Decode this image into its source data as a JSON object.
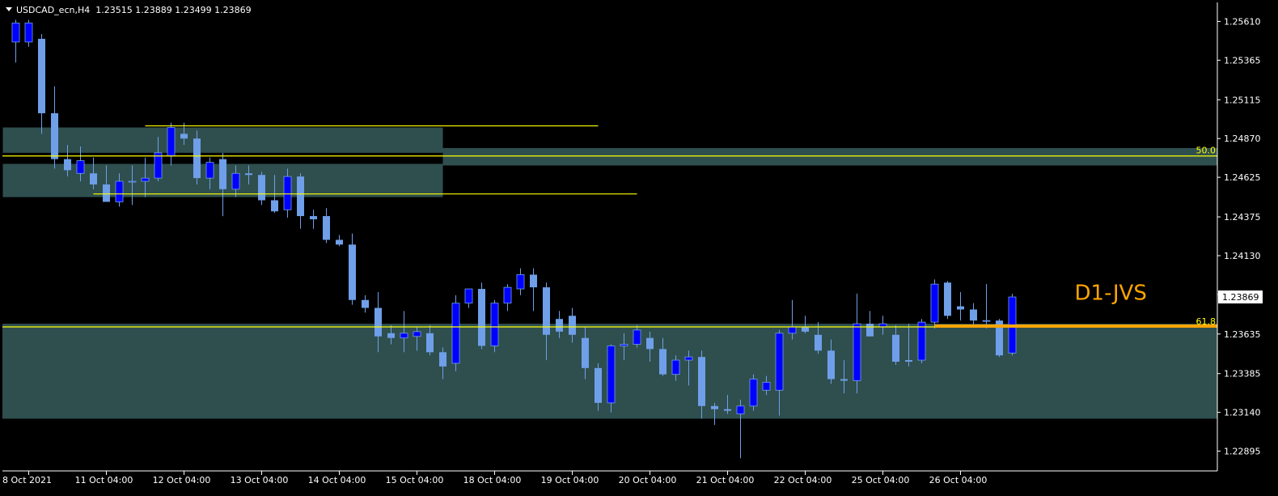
{
  "header": {
    "symbol_line": "USDCAD_ecn,H4  1.23515 1.23889 1.23499 1.23869"
  },
  "colors": {
    "background": "#000000",
    "axis": "#ffffff",
    "text": "#ffffff",
    "bull": "#0000ff",
    "bear": "#6f9fe8",
    "wick": "#6f9fe8",
    "zone": "#2f4f4f",
    "yellow": "#ffff00",
    "orange": "#ffa500",
    "red_arrow": "#ff0000",
    "fib_text": "#ffff00"
  },
  "chart_data": {
    "type": "candlestick",
    "ylim": [
      1.2277,
      1.2573
    ],
    "y_ticks": [
      "1.25610",
      "1.25365",
      "1.25115",
      "1.24870",
      "1.24625",
      "1.24375",
      "1.24130",
      "1.23885",
      "1.23635",
      "1.23385",
      "1.23140",
      "1.22895"
    ],
    "y_tick_values": [
      1.2561,
      1.25365,
      1.25115,
      1.2487,
      1.24625,
      1.24375,
      1.2413,
      1.23885,
      1.23635,
      1.23385,
      1.2314,
      1.22895
    ],
    "x_labels": [
      {
        "label": "8 Oct 2021",
        "index": 1
      },
      {
        "label": "11 Oct 04:00",
        "index": 7
      },
      {
        "label": "12 Oct 04:00",
        "index": 13
      },
      {
        "label": "13 Oct 04:00",
        "index": 19
      },
      {
        "label": "14 Oct 04:00",
        "index": 25
      },
      {
        "label": "15 Oct 04:00",
        "index": 31
      },
      {
        "label": "18 Oct 04:00",
        "index": 37
      },
      {
        "label": "19 Oct 04:00",
        "index": 43
      },
      {
        "label": "20 Oct 04:00",
        "index": 49
      },
      {
        "label": "21 Oct 04:00",
        "index": 55
      },
      {
        "label": "22 Oct 04:00",
        "index": 61
      },
      {
        "label": "25 Oct 04:00",
        "index": 67
      },
      {
        "label": "26 Oct 04:00",
        "index": 73
      }
    ],
    "current_price": "1.23869",
    "current_price_value": 1.23869,
    "candles": [
      {
        "o": 1.2548,
        "h": 1.2562,
        "l": 1.2535,
        "c": 1.256
      },
      {
        "o": 1.2548,
        "h": 1.2562,
        "l": 1.2545,
        "c": 1.256
      },
      {
        "o": 1.255,
        "h": 1.2553,
        "l": 1.249,
        "c": 1.2503
      },
      {
        "o": 1.2503,
        "h": 1.252,
        "l": 1.2468,
        "c": 1.2474
      },
      {
        "o": 1.2474,
        "h": 1.2483,
        "l": 1.2463,
        "c": 1.2467
      },
      {
        "o": 1.2465,
        "h": 1.2482,
        "l": 1.246,
        "c": 1.2473
      },
      {
        "o": 1.2465,
        "h": 1.2475,
        "l": 1.2455,
        "c": 1.2458
      },
      {
        "o": 1.2458,
        "h": 1.247,
        "l": 1.245,
        "c": 1.2447
      },
      {
        "o": 1.2447,
        "h": 1.2465,
        "l": 1.2444,
        "c": 1.246
      },
      {
        "o": 1.246,
        "h": 1.247,
        "l": 1.2445,
        "c": 1.246
      },
      {
        "o": 1.246,
        "h": 1.2475,
        "l": 1.245,
        "c": 1.2462
      },
      {
        "o": 1.2462,
        "h": 1.2488,
        "l": 1.246,
        "c": 1.2478
      },
      {
        "o": 1.2476,
        "h": 1.2497,
        "l": 1.247,
        "c": 1.2494
      },
      {
        "o": 1.249,
        "h": 1.2497,
        "l": 1.2483,
        "c": 1.2487
      },
      {
        "o": 1.2487,
        "h": 1.2492,
        "l": 1.2458,
        "c": 1.2462
      },
      {
        "o": 1.2462,
        "h": 1.2475,
        "l": 1.2455,
        "c": 1.2472
      },
      {
        "o": 1.2474,
        "h": 1.2478,
        "l": 1.2438,
        "c": 1.2455
      },
      {
        "o": 1.2455,
        "h": 1.247,
        "l": 1.245,
        "c": 1.2465
      },
      {
        "o": 1.2465,
        "h": 1.247,
        "l": 1.2458,
        "c": 1.2464
      },
      {
        "o": 1.2464,
        "h": 1.2466,
        "l": 1.2445,
        "c": 1.2448
      },
      {
        "o": 1.2448,
        "h": 1.2464,
        "l": 1.244,
        "c": 1.2441
      },
      {
        "o": 1.2442,
        "h": 1.2468,
        "l": 1.2437,
        "c": 1.2463
      },
      {
        "o": 1.2463,
        "h": 1.2465,
        "l": 1.243,
        "c": 1.2438
      },
      {
        "o": 1.2438,
        "h": 1.2442,
        "l": 1.243,
        "c": 1.2436
      },
      {
        "o": 1.2438,
        "h": 1.2443,
        "l": 1.2421,
        "c": 1.2423
      },
      {
        "o": 1.2423,
        "h": 1.2426,
        "l": 1.2419,
        "c": 1.242
      },
      {
        "o": 1.242,
        "h": 1.2427,
        "l": 1.2382,
        "c": 1.2385
      },
      {
        "o": 1.2385,
        "h": 1.2388,
        "l": 1.2377,
        "c": 1.238
      },
      {
        "o": 1.238,
        "h": 1.239,
        "l": 1.2352,
        "c": 1.2362
      },
      {
        "o": 1.2364,
        "h": 1.2369,
        "l": 1.2357,
        "c": 1.2361
      },
      {
        "o": 1.2361,
        "h": 1.2378,
        "l": 1.2352,
        "c": 1.2364
      },
      {
        "o": 1.2362,
        "h": 1.2368,
        "l": 1.2353,
        "c": 1.2365
      },
      {
        "o": 1.2364,
        "h": 1.2369,
        "l": 1.235,
        "c": 1.2352
      },
      {
        "o": 1.2352,
        "h": 1.2355,
        "l": 1.2335,
        "c": 1.2343
      },
      {
        "o": 1.2345,
        "h": 1.2388,
        "l": 1.234,
        "c": 1.2383
      },
      {
        "o": 1.2383,
        "h": 1.2392,
        "l": 1.238,
        "c": 1.2392
      },
      {
        "o": 1.2392,
        "h": 1.2396,
        "l": 1.2354,
        "c": 1.2356
      },
      {
        "o": 1.2356,
        "h": 1.2385,
        "l": 1.2352,
        "c": 1.2383
      },
      {
        "o": 1.2383,
        "h": 1.2395,
        "l": 1.2378,
        "c": 1.2393
      },
      {
        "o": 1.2392,
        "h": 1.2405,
        "l": 1.2388,
        "c": 1.2401
      },
      {
        "o": 1.2401,
        "h": 1.2405,
        "l": 1.2378,
        "c": 1.2393
      },
      {
        "o": 1.2393,
        "h": 1.2396,
        "l": 1.2347,
        "c": 1.2363
      },
      {
        "o": 1.2373,
        "h": 1.2378,
        "l": 1.2361,
        "c": 1.2365
      },
      {
        "o": 1.2375,
        "h": 1.238,
        "l": 1.2358,
        "c": 1.2363
      },
      {
        "o": 1.2361,
        "h": 1.2368,
        "l": 1.2335,
        "c": 1.2342
      },
      {
        "o": 1.2342,
        "h": 1.2345,
        "l": 1.2315,
        "c": 1.232
      },
      {
        "o": 1.232,
        "h": 1.2357,
        "l": 1.2314,
        "c": 1.2356
      },
      {
        "o": 1.2356,
        "h": 1.2364,
        "l": 1.2347,
        "c": 1.2357
      },
      {
        "o": 1.2357,
        "h": 1.2369,
        "l": 1.2355,
        "c": 1.2366
      },
      {
        "o": 1.2361,
        "h": 1.2365,
        "l": 1.2346,
        "c": 1.2354
      },
      {
        "o": 1.2354,
        "h": 1.2361,
        "l": 1.2337,
        "c": 1.2338
      },
      {
        "o": 1.2338,
        "h": 1.235,
        "l": 1.2334,
        "c": 1.2347
      },
      {
        "o": 1.2347,
        "h": 1.2353,
        "l": 1.2331,
        "c": 1.2349
      },
      {
        "o": 1.2349,
        "h": 1.2353,
        "l": 1.231,
        "c": 1.2318
      },
      {
        "o": 1.2318,
        "h": 1.232,
        "l": 1.2306,
        "c": 1.2316
      },
      {
        "o": 1.2316,
        "h": 1.2325,
        "l": 1.2313,
        "c": 1.2315
      },
      {
        "o": 1.2313,
        "h": 1.2322,
        "l": 1.2285,
        "c": 1.2318
      },
      {
        "o": 1.2318,
        "h": 1.2338,
        "l": 1.2315,
        "c": 1.2335
      },
      {
        "o": 1.2328,
        "h": 1.2337,
        "l": 1.2325,
        "c": 1.2333
      },
      {
        "o": 1.2328,
        "h": 1.2366,
        "l": 1.2312,
        "c": 1.2364
      },
      {
        "o": 1.2364,
        "h": 1.2385,
        "l": 1.236,
        "c": 1.2368
      },
      {
        "o": 1.2368,
        "h": 1.2375,
        "l": 1.2364,
        "c": 1.2365
      },
      {
        "o": 1.2363,
        "h": 1.2371,
        "l": 1.2351,
        "c": 1.2353
      },
      {
        "o": 1.2353,
        "h": 1.236,
        "l": 1.2332,
        "c": 1.2335
      },
      {
        "o": 1.2335,
        "h": 1.2347,
        "l": 1.2326,
        "c": 1.2334
      },
      {
        "o": 1.2334,
        "h": 1.2389,
        "l": 1.2326,
        "c": 1.237
      },
      {
        "o": 1.237,
        "h": 1.2378,
        "l": 1.2362,
        "c": 1.2362
      },
      {
        "o": 1.2368,
        "h": 1.2375,
        "l": 1.2363,
        "c": 1.237
      },
      {
        "o": 1.2363,
        "h": 1.2369,
        "l": 1.2344,
        "c": 1.2346
      },
      {
        "o": 1.2347,
        "h": 1.237,
        "l": 1.2343,
        "c": 1.2346
      },
      {
        "o": 1.2347,
        "h": 1.2373,
        "l": 1.2345,
        "c": 1.2371
      },
      {
        "o": 1.2371,
        "h": 1.2398,
        "l": 1.2367,
        "c": 1.2395
      },
      {
        "o": 1.2396,
        "h": 1.2397,
        "l": 1.2373,
        "c": 1.2375
      },
      {
        "o": 1.2381,
        "h": 1.239,
        "l": 1.2372,
        "c": 1.2379
      },
      {
        "o": 1.2379,
        "h": 1.2383,
        "l": 1.2368,
        "c": 1.2372
      },
      {
        "o": 1.2372,
        "h": 1.2395,
        "l": 1.2367,
        "c": 1.2372
      },
      {
        "o": 1.2372,
        "h": 1.2373,
        "l": 1.2349,
        "c": 1.235
      },
      {
        "o": 1.23515,
        "h": 1.23889,
        "l": 1.23499,
        "c": 1.23869
      }
    ],
    "zones": [
      {
        "y_top": 1.2494,
        "y_bottom": 1.2478,
        "from": -1,
        "to": 33
      },
      {
        "y_top": 1.2471,
        "y_bottom": 1.245,
        "from": -1,
        "to": 33
      },
      {
        "y_top": 1.2481,
        "y_bottom": 1.247,
        "from": 33,
        "to": 134
      },
      {
        "y_top": 1.237,
        "y_bottom": 1.231,
        "from": -4,
        "to": 160
      }
    ],
    "hlines": [
      {
        "y": 1.2495,
        "from": 10,
        "to": 45,
        "color": "yellow"
      },
      {
        "y": 1.2452,
        "from": 6,
        "to": 48,
        "color": "yellow"
      },
      {
        "y": 1.2476,
        "from": -4,
        "to": 160,
        "color": "yellow",
        "label": "50.0"
      },
      {
        "y": 1.2368,
        "from": -4,
        "to": 160,
        "color": "yellow",
        "label": "61.8"
      },
      {
        "y": 1.23685,
        "from": 71,
        "to": 131,
        "color": "orange",
        "thick": true
      }
    ],
    "annotations": {
      "label_text": "D1-JVS",
      "label_price": 1.2385,
      "label_index": 84,
      "checkmark": "✓",
      "checkmark_price": 1.2485,
      "checkmark_index": 119,
      "arrow_price": 1.234,
      "arrow_index": 118
    }
  }
}
